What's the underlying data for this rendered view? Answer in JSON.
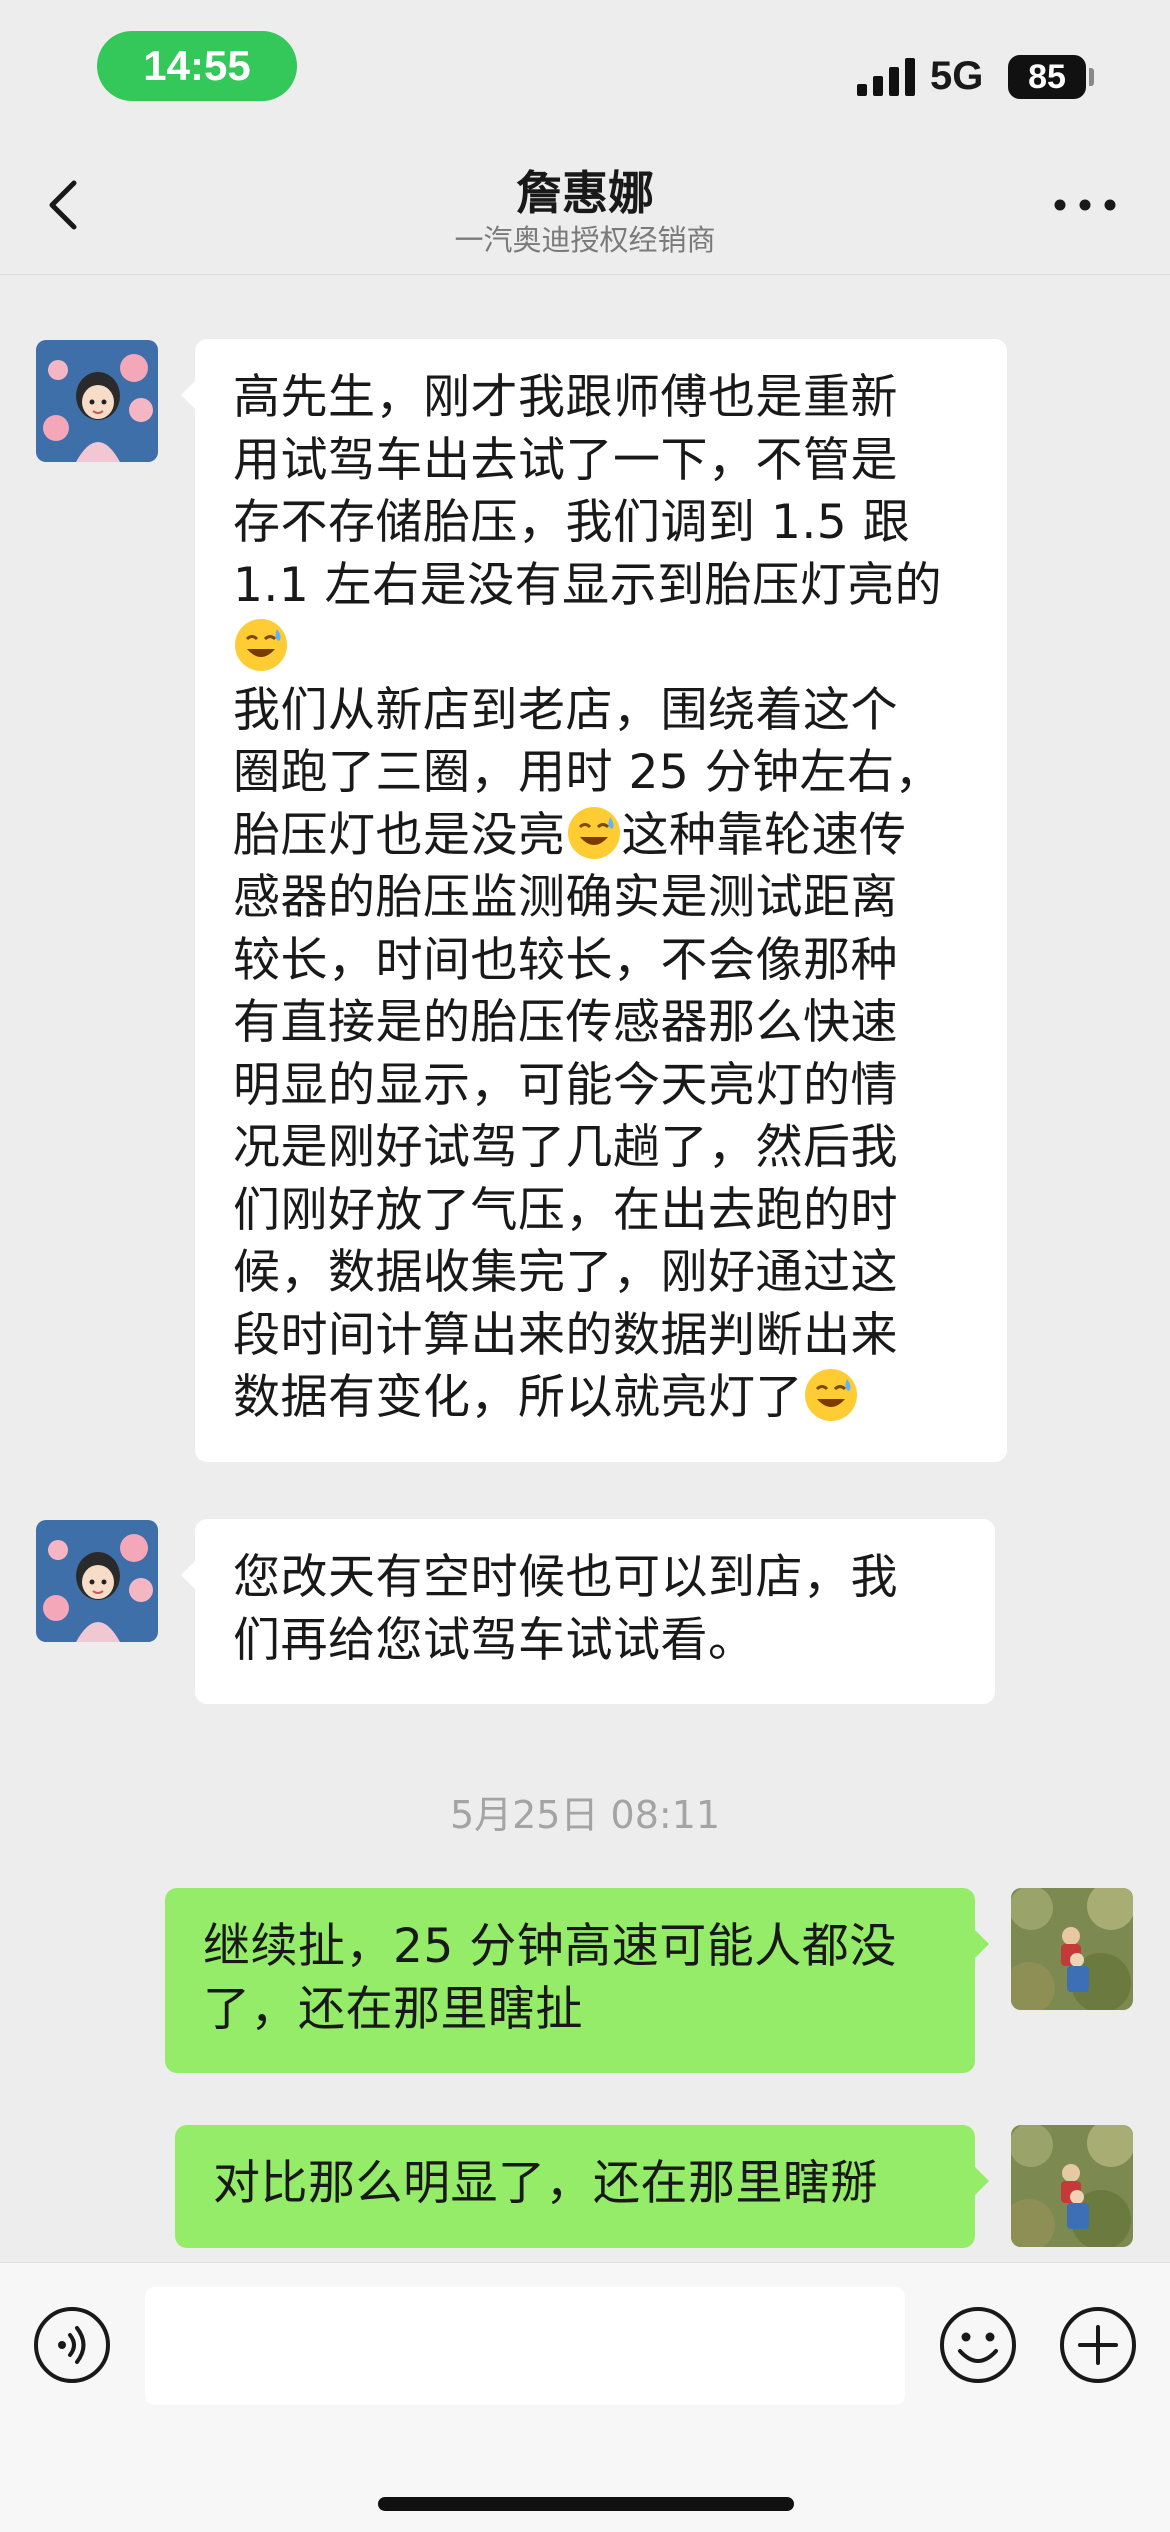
{
  "status_bar": {
    "time": "14:55",
    "network": "5G",
    "battery": "85",
    "time_pill_color": "#34c759"
  },
  "header": {
    "title": "詹惠娜",
    "subtitle": "一汽奥迪授权经销商",
    "back_icon": "chevron-left-icon",
    "more_icon": "ellipsis-icon"
  },
  "messages": [
    {
      "side": "left",
      "sender": "詹惠娜",
      "lines": [
        "高先生，刚才我跟师傅也是重新",
        "用试驾车出去试了一下，不管是",
        "存不存储胎压，我们调到 1.5 跟",
        "1.1 左右是没有显示到胎压灯亮的",
        "[emoji]",
        "我们从新店到老店，围绕着这个",
        "圈跑了三圈，用时 25 分钟左右，",
        "胎压灯也是没亮[emoji]这种靠轮速传",
        "感器的胎压监测确实是测试距离",
        "较长，时间也较长，不会像那种",
        "有直接是的胎压传感器那么快速",
        "明显的显示，可能今天亮灯的情",
        "况是刚好试驾了几趟了，然后我",
        "们刚好放了气压，在出去跑的时",
        "候，数据收集完了，刚好通过这",
        "段时间计算出来的数据判断出来",
        "数据有变化，所以就亮灯了[emoji]"
      ],
      "emoji_name": "grinning-sweat-emoji"
    },
    {
      "side": "left",
      "sender": "詹惠娜",
      "lines": [
        "您改天有空时候也可以到店，我",
        "们再给您试驾车试试看。"
      ]
    },
    {
      "type": "timestamp",
      "text": "5月25日 08:11"
    },
    {
      "side": "right",
      "sender": "me",
      "lines": [
        "继续扯，25 分钟高速可能人都没",
        "了，还在那里瞎扯"
      ]
    },
    {
      "side": "right",
      "sender": "me",
      "lines": [
        "对比那么明显了，还在那里瞎掰"
      ]
    }
  ],
  "input_bar": {
    "voice_icon": "voice-icon",
    "emoji_icon": "smiley-icon",
    "plus_icon": "plus-icon",
    "placeholder": ""
  },
  "colors": {
    "background": "#ededed",
    "bubble_left": "#ffffff",
    "bubble_right": "#95ec69"
  }
}
